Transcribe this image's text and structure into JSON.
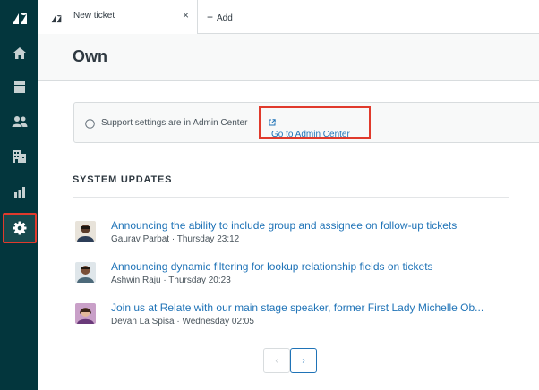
{
  "nav": {
    "items": [
      {
        "name": "logo"
      },
      {
        "name": "home"
      },
      {
        "name": "views"
      },
      {
        "name": "customers"
      },
      {
        "name": "organizations"
      },
      {
        "name": "reporting"
      },
      {
        "name": "admin"
      }
    ],
    "active": "admin"
  },
  "tabs": {
    "current": {
      "label": "New ticket",
      "close": "×"
    },
    "add_label": "Add"
  },
  "header": {
    "title": "Own"
  },
  "notice": {
    "text": "Support settings are in Admin Center",
    "link_label": "Go to Admin Center",
    "link_icon": "external-link-icon"
  },
  "updates": {
    "title": "SYSTEM UPDATES",
    "items": [
      {
        "title": "Announcing the ability to include group and assignee on follow-up tickets",
        "meta": "Gaurav Parbat · Thursday 23:12"
      },
      {
        "title": "Announcing dynamic filtering for lookup relationship fields on tickets",
        "meta": "Ashwin Raju · Thursday 20:23"
      },
      {
        "title": "Join us at Relate with our main stage speaker, former First Lady Michelle Ob...",
        "meta": "Devan La Spisa · Wednesday 02:05"
      }
    ]
  },
  "pagination": {
    "prev": "‹",
    "next": "›"
  },
  "colors": {
    "nav_bg": "#03363d",
    "link": "#1f73b7",
    "highlight": "#e03a2c"
  }
}
